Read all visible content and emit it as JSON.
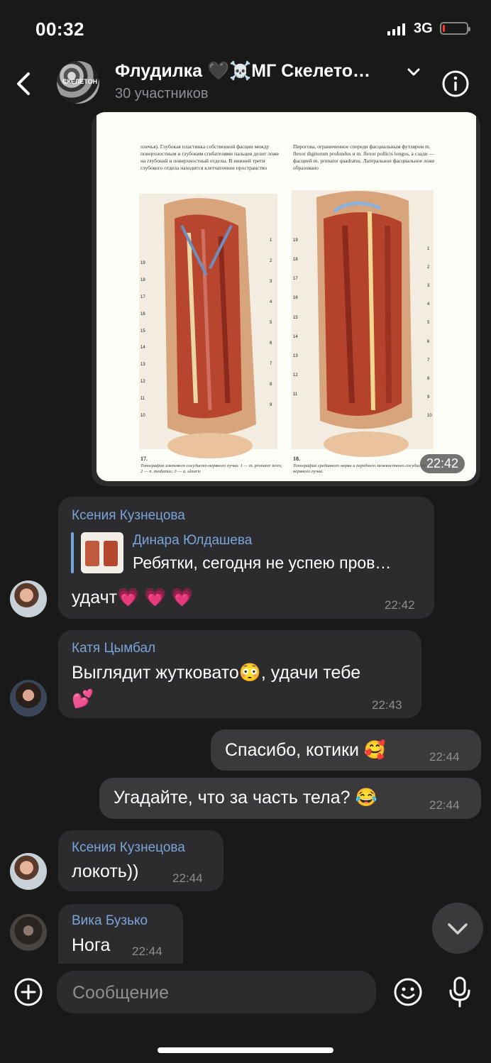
{
  "status_bar": {
    "time": "00:32",
    "network": "3G",
    "battery_level": 0.1,
    "battery_color": "#ff3b30"
  },
  "header": {
    "title": "Флудилка 🖤☠️МГ Скелето…",
    "subtitle": "30 участников",
    "avatar_mark": "СКЕЛЕТОН",
    "icons": [
      "back-icon",
      "chevron-down-icon",
      "info-icon"
    ]
  },
  "image_message": {
    "time": "22:42",
    "text_left": "плечья). Глубокая пластинка собственной фасции между поверхностным и глубоким сгибателями пальцев делит ложе на глубокий и поверхностный отделы. В нижней трети глубокого отдела находится клетчаточное пространство",
    "text_right": "Пирогова, ограниченное спереди фасциальным футляром m. flexor digitorum profundus и m. flexor pollicis longus, а сзади — фасцией m. pronator quadratus. Латеральное фасциальное ложе образовано",
    "fig_left_num": "17.",
    "fig_left_caption": "Топография локтевого сосудисто-нервного пучка. 1 — m. pronator teres; 2 — n. medianus; 3 — a. ulnaris",
    "fig_right_num": "18.",
    "fig_right_caption": "Топография срединного нерва и переднего межкостного сосудисто-нервного пучка.",
    "left_labels_side": [
      "19",
      "18",
      "17",
      "16",
      "15",
      "14",
      "13",
      "12",
      "11",
      "10"
    ],
    "left_labels_right": [
      "1",
      "2",
      "3",
      "4",
      "5",
      "6",
      "7",
      "8",
      "9"
    ],
    "right_labels_side": [
      "19",
      "18",
      "17",
      "16",
      "15",
      "14",
      "13",
      "12",
      "11"
    ],
    "right_labels_right": [
      "1",
      "2",
      "3",
      "4",
      "5",
      "6",
      "7",
      "8",
      "9",
      "10"
    ]
  },
  "messages": [
    {
      "sender": "Ксения Кузнецова",
      "reply_author": "Динара Юлдашева",
      "reply_text": "Ребятки, сегодня не успею пров…",
      "text": "удачт💗 💗 💗",
      "time": "22:42"
    },
    {
      "sender": "Катя Цымбал",
      "text_line1": "Выглядит жутковато😳, удачи тебе",
      "text_line2": "💕",
      "time": "22:43"
    },
    {
      "outgoing": true,
      "text": "Спасибо, котики 🥰",
      "time": "22:44"
    },
    {
      "outgoing": true,
      "text": "Угадайте, что за часть тела? 😂",
      "time": "22:44"
    },
    {
      "sender": "Ксения Кузнецова",
      "text": "локоть))",
      "time": "22:44"
    },
    {
      "sender": "Вика Бузько",
      "text": "Нога",
      "time": "22:44"
    }
  ],
  "composer": {
    "placeholder": "Сообщение",
    "icons": [
      "plus-icon",
      "emoji-icon",
      "microphone-icon"
    ]
  },
  "colors": {
    "background": "#19191a",
    "bubble_in": "#2c2c2e",
    "bubble_out": "#3a3a3c",
    "sender_name": "#7aa4d8",
    "muted": "#8e8e93"
  }
}
